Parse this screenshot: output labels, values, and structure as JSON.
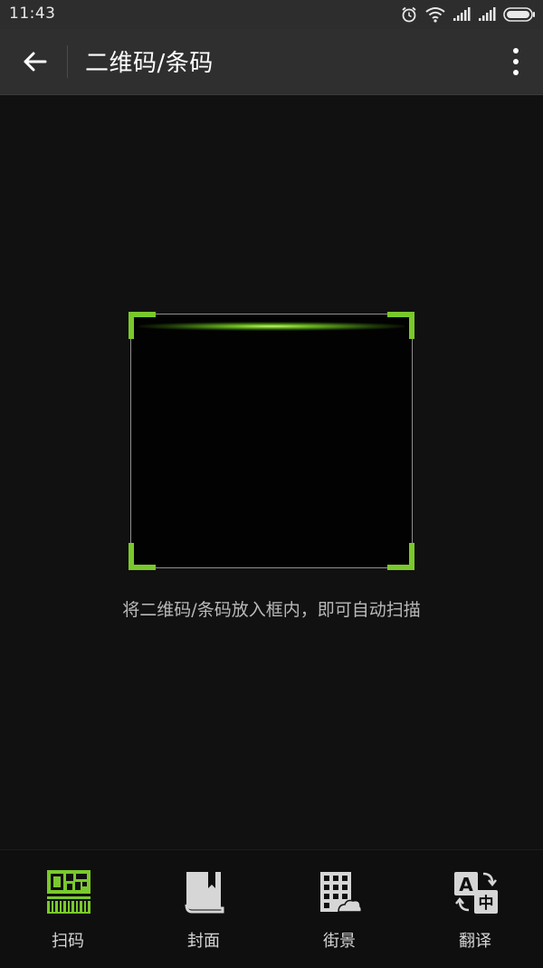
{
  "status_bar": {
    "time": "11:43"
  },
  "app_bar": {
    "title": "二维码/条码"
  },
  "scanner": {
    "hint": "将二维码/条码放入框内，即可自动扫描",
    "accent_color": "#7ac92c"
  },
  "tabs": [
    {
      "label": "扫码",
      "icon": "qr-barcode-icon",
      "active": true
    },
    {
      "label": "封面",
      "icon": "book-icon",
      "active": false
    },
    {
      "label": "街景",
      "icon": "street-building-icon",
      "active": false
    },
    {
      "label": "翻译",
      "icon": "translate-icon",
      "active": false
    }
  ]
}
